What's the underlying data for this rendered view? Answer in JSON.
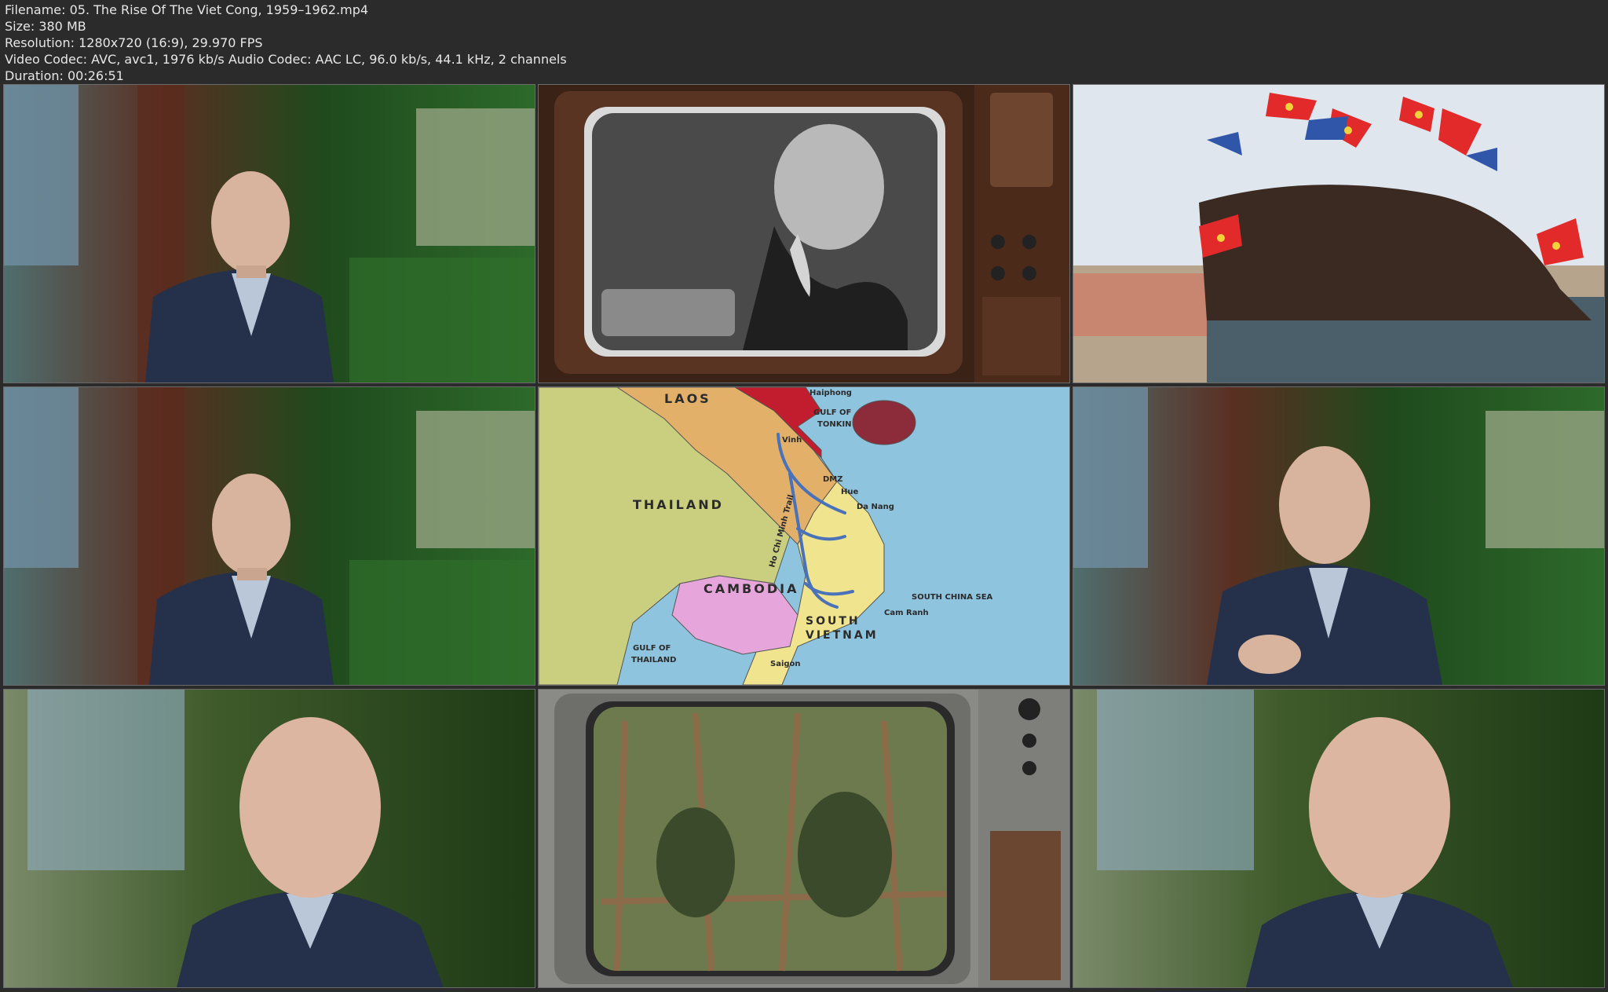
{
  "header": {
    "filename": "Filename: 05. The Rise Of The Viet Cong, 1959–1962.mp4",
    "size": "Size: 380 MB",
    "resolution": "Resolution: 1280x720 (16:9), 29.970 FPS",
    "codec": "Video Codec: AVC, avc1, 1976 kb/s Audio Codec: AAC LC, 96.0 kb/s, 44.1 kHz, 2 channels",
    "duration": "Duration: 00:26:51"
  },
  "map": {
    "laos": "LAOS",
    "thailand": "THAILAND",
    "cambodia": "CAMBODIA",
    "south_vietnam_1": "SOUTH",
    "south_vietnam_2": "VIETNAM",
    "gulf_tonkin_1": "GULF OF",
    "gulf_tonkin_2": "TONKIN",
    "gulf_thailand_1": "GULF OF",
    "gulf_thailand_2": "THAILAND",
    "south_china_sea": "SOUTH CHINA SEA",
    "haiphong": "Haiphong",
    "vinh": "Vinh",
    "dmz": "DMZ",
    "hue": "Hue",
    "da_nang": "Da Nang",
    "cam_ranh": "Cam Ranh",
    "saigon": "Saigon",
    "trail": "Ho Chi Minh Trail"
  },
  "colors": {
    "background": "#2b2b2b",
    "header_text": "#e6e6e6",
    "map_sea": "#8fc4de",
    "map_north_vietnam": "#c21d2e",
    "map_south_vietnam": "#f1e48f",
    "map_laos": "#e3b06a",
    "map_thailand": "#c9cf7e",
    "map_cambodia": "#e6a6dc",
    "trail": "#4a72b8"
  },
  "icons": [
    "speaker-portrait",
    "retro-tv",
    "crowd-with-flags",
    "vietnam-map"
  ]
}
